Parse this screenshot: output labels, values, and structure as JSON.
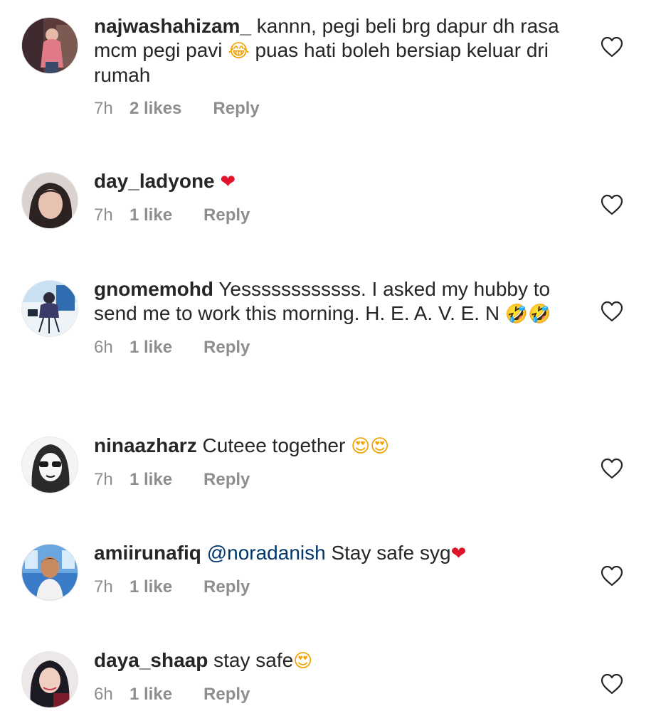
{
  "comments": [
    {
      "username": "najwashahizam_",
      "text_a": "kannn, pegi beli brg dapur dh rasa mcm pegi pavi ",
      "emoji_a": "😂",
      "text_b": " puas hati boleh bersiap keluar dri rumah",
      "time": "7h",
      "likes": "2 likes",
      "reply": "Reply"
    },
    {
      "username": "day_ladyone",
      "emoji_a": "❤",
      "time": "7h",
      "likes": "1 like",
      "reply": "Reply"
    },
    {
      "username": "gnomemohd",
      "text_a": "Yessssssssssss. I asked my hubby to send me to work this morning. H. E. A. V. E. N ",
      "emoji_a": "🤣🤣",
      "time": "6h",
      "likes": "1 like",
      "reply": "Reply"
    },
    {
      "username": "ninaazharz",
      "text_a": "Cuteee together ",
      "emoji_a": "😍😍",
      "time": "7h",
      "likes": "1 like",
      "reply": "Reply"
    },
    {
      "username": "amiirunafiq",
      "mention": "@noradanish",
      "text_a": " Stay safe syg",
      "emoji_a": "❤",
      "time": "7h",
      "likes": "1 like",
      "reply": "Reply"
    },
    {
      "username": "daya_shaap",
      "text_a": "stay safe",
      "emoji_a": "😍",
      "time": "6h",
      "likes": "1 like",
      "reply": "Reply"
    }
  ],
  "icons": {
    "like": "heart-outline-icon"
  },
  "colors": {
    "text": "#262626",
    "meta": "#8e8e8e",
    "mention": "#00376b",
    "heart": "#e0142b"
  }
}
